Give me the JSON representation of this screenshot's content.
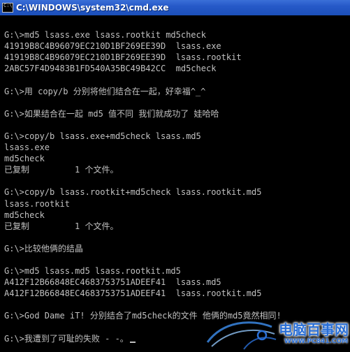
{
  "window": {
    "title": "C:\\WINDOWS\\system32\\cmd.exe"
  },
  "console": {
    "lines": [
      "",
      "G:\\>md5 lsass.exe lsass.rootkit md5check",
      "41919B8C4B96079EC210D1BF269EE39D  lsass.exe",
      "41919B8C4B96079EC210D1BF269EE39D  lsass.rootkit",
      "2ABC57F4D9483B1FD540A35BC49B42CC  md5check",
      "",
      "G:\\>用 copy/b 分别将他们结合在一起，好幸福^_^",
      "",
      "G:\\>如果结合在一起 md5 值不同 我们就成功了 娃哈哈",
      "",
      "G:\\>copy/b lsass.exe+md5check lsass.md5",
      "lsass.exe",
      "md5check",
      "已复制         1 个文件。",
      "",
      "G:\\>copy/b lsass.rootkit+md5check lsass.rootkit.md5",
      "lsass.rootkit",
      "md5check",
      "已复制         1 个文件。",
      "",
      "G:\\>比较他俩的结晶",
      "",
      "G:\\>md5 lsass.md5 lsass.rootkit.md5",
      "A412F12B66848EC4683753751ADEEF41  lsass.md5",
      "A412F12B66848EC4683753751ADEEF41  lsass.rootkit.md5",
      "",
      "G:\\>God Dame iT! 分别结合了md5check的文件 他俩的md5竟然相同!",
      "",
      "G:\\>我遭到了可耻的失败 - -。"
    ]
  },
  "watermark": {
    "brand": "电脑百事网",
    "url": "WWW.PC841.COM"
  },
  "colors": {
    "background": "#000000",
    "text": "#c0c0c0",
    "titlebar": "#2659c8"
  }
}
